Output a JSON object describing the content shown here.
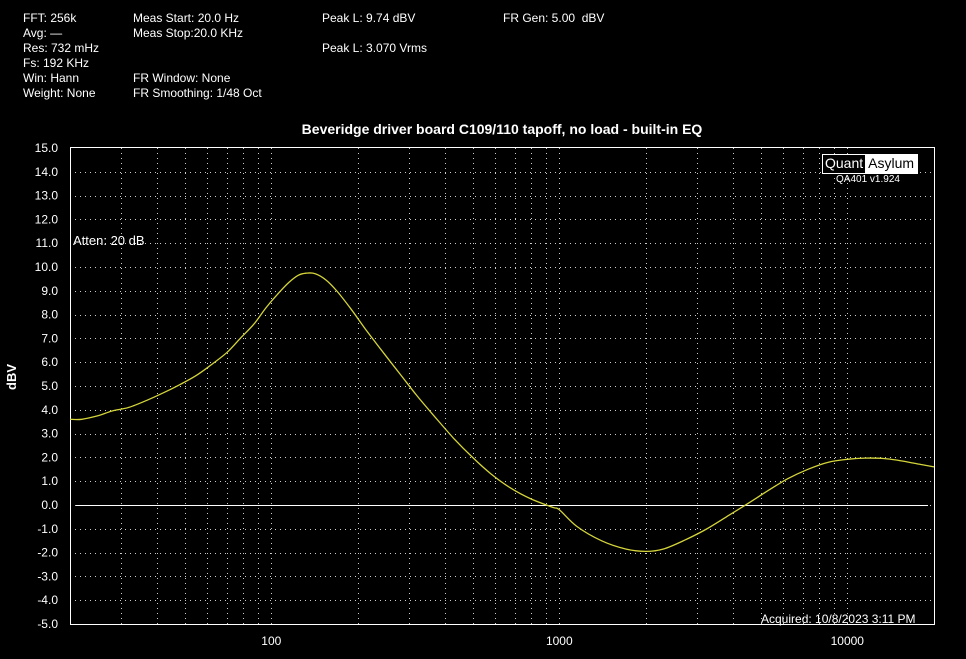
{
  "info": {
    "fft": "FFT: 256k",
    "avg": "Avg: —",
    "res": "Res: 732 mHz",
    "fs": "Fs: 192 KHz",
    "win": "Win: Hann",
    "weight": "Weight: None",
    "meas_start": "Meas Start: 20.0 Hz",
    "meas_stop": "Meas Stop:20.0 KHz",
    "fr_window": "FR Window: None",
    "fr_smoothing": "FR Smoothing: 1/48 Oct",
    "peak_dbv": "Peak L: 9.74 dBV",
    "peak_vrms": "Peak L: 3.070 Vrms",
    "fr_gen": "FR Gen: 5.00  dBV"
  },
  "brand": {
    "quant": "Quant",
    "asylum": "Asylum",
    "version": "QA401 v1.924"
  },
  "annotations": {
    "atten": "Atten: 20 dB",
    "acquired": "Acquired: 10/8/2023  3:11 PM"
  },
  "colors": {
    "trace": "#d4d43a",
    "grid": "#ffffff",
    "background": "#000000"
  },
  "chart_data": {
    "type": "line",
    "title": "Beveridge driver board C109/110 tapoff, no load - built-in EQ",
    "xlabel": "",
    "ylabel": "dBV",
    "xscale": "log",
    "xlim": [
      20,
      20000
    ],
    "ylim": [
      -5,
      15
    ],
    "x_ticks": [
      100,
      1000,
      10000
    ],
    "x_tick_labels": [
      "100",
      "1000",
      "10000"
    ],
    "y_ticks": [
      15,
      14,
      13,
      12,
      11,
      10,
      9,
      8,
      7,
      6,
      5,
      4,
      3,
      2,
      1,
      0,
      -1,
      -2,
      -3,
      -4,
      -5
    ],
    "y_tick_labels": [
      "15.0",
      "14.0",
      "13.0",
      "12.0",
      "11.0",
      "10.0",
      "9.0",
      "8.0",
      "7.0",
      "6.0",
      "5.0",
      "4.0",
      "3.0",
      "2.0",
      "1.0",
      "0.0",
      "-1.0",
      "-2.0",
      "-3.0",
      "-4.0",
      "-5.0"
    ],
    "grid": true,
    "reference_line": 0,
    "series": [
      {
        "values": [
          {
            "x": 20,
            "y": 3.6
          },
          {
            "x": 22,
            "y": 3.6
          },
          {
            "x": 25,
            "y": 3.75
          },
          {
            "x": 28,
            "y": 3.95
          },
          {
            "x": 32,
            "y": 4.1
          },
          {
            "x": 37,
            "y": 4.4
          },
          {
            "x": 42,
            "y": 4.7
          },
          {
            "x": 48,
            "y": 5.05
          },
          {
            "x": 55,
            "y": 5.45
          },
          {
            "x": 62,
            "y": 5.9
          },
          {
            "x": 70,
            "y": 6.4
          },
          {
            "x": 78,
            "y": 7.0
          },
          {
            "x": 87,
            "y": 7.6
          },
          {
            "x": 96,
            "y": 8.3
          },
          {
            "x": 105,
            "y": 8.85
          },
          {
            "x": 115,
            "y": 9.35
          },
          {
            "x": 124,
            "y": 9.65
          },
          {
            "x": 132,
            "y": 9.74
          },
          {
            "x": 142,
            "y": 9.72
          },
          {
            "x": 155,
            "y": 9.45
          },
          {
            "x": 170,
            "y": 8.95
          },
          {
            "x": 190,
            "y": 8.2
          },
          {
            "x": 215,
            "y": 7.3
          },
          {
            "x": 245,
            "y": 6.4
          },
          {
            "x": 280,
            "y": 5.5
          },
          {
            "x": 320,
            "y": 4.6
          },
          {
            "x": 370,
            "y": 3.7
          },
          {
            "x": 430,
            "y": 2.8
          },
          {
            "x": 500,
            "y": 2.0
          },
          {
            "x": 580,
            "y": 1.3
          },
          {
            "x": 680,
            "y": 0.7
          },
          {
            "x": 800,
            "y": 0.25
          },
          {
            "x": 950,
            "y": -0.1
          },
          {
            "x": 1000,
            "y": -0.2
          },
          {
            "x": 1150,
            "y": -0.9
          },
          {
            "x": 1400,
            "y": -1.5
          },
          {
            "x": 1700,
            "y": -1.85
          },
          {
            "x": 2000,
            "y": -1.95
          },
          {
            "x": 2300,
            "y": -1.85
          },
          {
            "x": 2700,
            "y": -1.5
          },
          {
            "x": 3200,
            "y": -1.05
          },
          {
            "x": 3800,
            "y": -0.5
          },
          {
            "x": 4500,
            "y": 0.05
          },
          {
            "x": 5300,
            "y": 0.6
          },
          {
            "x": 6200,
            "y": 1.1
          },
          {
            "x": 7300,
            "y": 1.5
          },
          {
            "x": 8600,
            "y": 1.8
          },
          {
            "x": 10000,
            "y": 1.92
          },
          {
            "x": 11500,
            "y": 1.97
          },
          {
            "x": 13500,
            "y": 1.95
          },
          {
            "x": 15500,
            "y": 1.85
          },
          {
            "x": 18000,
            "y": 1.7
          },
          {
            "x": 20000,
            "y": 1.6
          }
        ]
      }
    ]
  }
}
